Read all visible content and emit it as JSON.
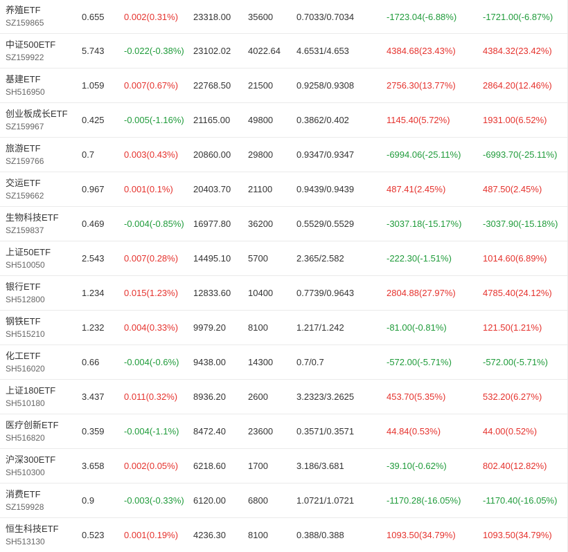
{
  "colors": {
    "up": "#e5322d",
    "down": "#1f9b3a",
    "text": "#333333",
    "code": "#666666"
  },
  "rows": [
    {
      "name": "养殖ETF",
      "code": "SZ159865",
      "price": "0.655",
      "change": "0.002(0.31%)",
      "change_dir": "up",
      "amount": "23318.00",
      "volume": "35600",
      "nav": "0.7033/0.7034",
      "profit1": "-1723.04(-6.88%)",
      "profit1_dir": "down",
      "profit2": "-1721.00(-6.87%)",
      "profit2_dir": "down"
    },
    {
      "name": "中证500ETF",
      "code": "SZ159922",
      "price": "5.743",
      "change": "-0.022(-0.38%)",
      "change_dir": "down",
      "amount": "23102.02",
      "volume": "4022.64",
      "nav": "4.6531/4.653",
      "profit1": "4384.68(23.43%)",
      "profit1_dir": "up",
      "profit2": "4384.32(23.42%)",
      "profit2_dir": "up"
    },
    {
      "name": "基建ETF",
      "code": "SH516950",
      "price": "1.059",
      "change": "0.007(0.67%)",
      "change_dir": "up",
      "amount": "22768.50",
      "volume": "21500",
      "nav": "0.9258/0.9308",
      "profit1": "2756.30(13.77%)",
      "profit1_dir": "up",
      "profit2": "2864.20(12.46%)",
      "profit2_dir": "up"
    },
    {
      "name": "创业板成长ETF",
      "code": "SZ159967",
      "price": "0.425",
      "change": "-0.005(-1.16%)",
      "change_dir": "down",
      "amount": "21165.00",
      "volume": "49800",
      "nav": "0.3862/0.402",
      "profit1": "1145.40(5.72%)",
      "profit1_dir": "up",
      "profit2": "1931.00(6.52%)",
      "profit2_dir": "up"
    },
    {
      "name": "旅游ETF",
      "code": "SZ159766",
      "price": "0.7",
      "change": "0.003(0.43%)",
      "change_dir": "up",
      "amount": "20860.00",
      "volume": "29800",
      "nav": "0.9347/0.9347",
      "profit1": "-6994.06(-25.11%)",
      "profit1_dir": "down",
      "profit2": "-6993.70(-25.11%)",
      "profit2_dir": "down"
    },
    {
      "name": "交运ETF",
      "code": "SZ159662",
      "price": "0.967",
      "change": "0.001(0.1%)",
      "change_dir": "up",
      "amount": "20403.70",
      "volume": "21100",
      "nav": "0.9439/0.9439",
      "profit1": "487.41(2.45%)",
      "profit1_dir": "up",
      "profit2": "487.50(2.45%)",
      "profit2_dir": "up"
    },
    {
      "name": "生物科技ETF",
      "code": "SZ159837",
      "price": "0.469",
      "change": "-0.004(-0.85%)",
      "change_dir": "down",
      "amount": "16977.80",
      "volume": "36200",
      "nav": "0.5529/0.5529",
      "profit1": "-3037.18(-15.17%)",
      "profit1_dir": "down",
      "profit2": "-3037.90(-15.18%)",
      "profit2_dir": "down"
    },
    {
      "name": "上证50ETF",
      "code": "SH510050",
      "price": "2.543",
      "change": "0.007(0.28%)",
      "change_dir": "up",
      "amount": "14495.10",
      "volume": "5700",
      "nav": "2.365/2.582",
      "profit1": "-222.30(-1.51%)",
      "profit1_dir": "down",
      "profit2": "1014.60(6.89%)",
      "profit2_dir": "up"
    },
    {
      "name": "银行ETF",
      "code": "SH512800",
      "price": "1.234",
      "change": "0.015(1.23%)",
      "change_dir": "up",
      "amount": "12833.60",
      "volume": "10400",
      "nav": "0.7739/0.9643",
      "profit1": "2804.88(27.97%)",
      "profit1_dir": "up",
      "profit2": "4785.40(24.12%)",
      "profit2_dir": "up"
    },
    {
      "name": "钢铁ETF",
      "code": "SH515210",
      "price": "1.232",
      "change": "0.004(0.33%)",
      "change_dir": "up",
      "amount": "9979.20",
      "volume": "8100",
      "nav": "1.217/1.242",
      "profit1": "-81.00(-0.81%)",
      "profit1_dir": "down",
      "profit2": "121.50(1.21%)",
      "profit2_dir": "up"
    },
    {
      "name": "化工ETF",
      "code": "SH516020",
      "price": "0.66",
      "change": "-0.004(-0.6%)",
      "change_dir": "down",
      "amount": "9438.00",
      "volume": "14300",
      "nav": "0.7/0.7",
      "profit1": "-572.00(-5.71%)",
      "profit1_dir": "down",
      "profit2": "-572.00(-5.71%)",
      "profit2_dir": "down"
    },
    {
      "name": "上证180ETF",
      "code": "SH510180",
      "price": "3.437",
      "change": "0.011(0.32%)",
      "change_dir": "up",
      "amount": "8936.20",
      "volume": "2600",
      "nav": "3.2323/3.2625",
      "profit1": "453.70(5.35%)",
      "profit1_dir": "up",
      "profit2": "532.20(6.27%)",
      "profit2_dir": "up"
    },
    {
      "name": "医疗创新ETF",
      "code": "SH516820",
      "price": "0.359",
      "change": "-0.004(-1.1%)",
      "change_dir": "down",
      "amount": "8472.40",
      "volume": "23600",
      "nav": "0.3571/0.3571",
      "profit1": "44.84(0.53%)",
      "profit1_dir": "up",
      "profit2": "44.00(0.52%)",
      "profit2_dir": "up"
    },
    {
      "name": "沪深300ETF",
      "code": "SH510300",
      "price": "3.658",
      "change": "0.002(0.05%)",
      "change_dir": "up",
      "amount": "6218.60",
      "volume": "1700",
      "nav": "3.186/3.681",
      "profit1": "-39.10(-0.62%)",
      "profit1_dir": "down",
      "profit2": "802.40(12.82%)",
      "profit2_dir": "up"
    },
    {
      "name": "消费ETF",
      "code": "SZ159928",
      "price": "0.9",
      "change": "-0.003(-0.33%)",
      "change_dir": "down",
      "amount": "6120.00",
      "volume": "6800",
      "nav": "1.0721/1.0721",
      "profit1": "-1170.28(-16.05%)",
      "profit1_dir": "down",
      "profit2": "-1170.40(-16.05%)",
      "profit2_dir": "down"
    },
    {
      "name": "恒生科技ETF",
      "code": "SH513130",
      "price": "0.523",
      "change": "0.001(0.19%)",
      "change_dir": "up",
      "amount": "4236.30",
      "volume": "8100",
      "nav": "0.388/0.388",
      "profit1": "1093.50(34.79%)",
      "profit1_dir": "up",
      "profit2": "1093.50(34.79%)",
      "profit2_dir": "up"
    }
  ]
}
